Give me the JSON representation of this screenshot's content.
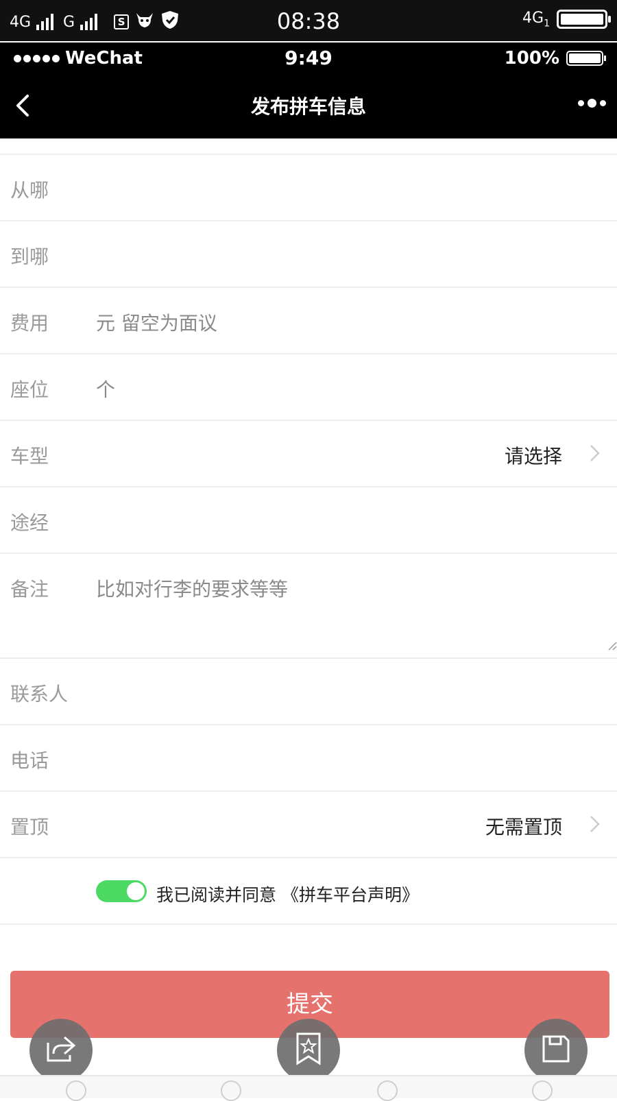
{
  "system_bar": {
    "net1": "4G",
    "net2": "G",
    "s_icon": "S",
    "time": "08:38",
    "net_right": "4G",
    "net_right_sub": "1"
  },
  "wechat_bar": {
    "carrier": "WeChat",
    "time": "9:49",
    "battery": "100%"
  },
  "nav": {
    "title": "发布拼车信息"
  },
  "form": {
    "from_label": "从哪",
    "to_label": "到哪",
    "fee_label": "费用",
    "fee_placeholder": "元 留空为面议",
    "seat_label": "座位",
    "seat_placeholder": "个",
    "car_label": "车型",
    "car_value": "请选择",
    "via_label": "途经",
    "note_label": "备注",
    "note_placeholder": "比如对行李的要求等等",
    "contact_label": "联系人",
    "phone_label": "电话",
    "top_label": "置顶",
    "top_value": "无需置顶",
    "agree_text": "我已阅读并同意 《拼车平台声明》",
    "agree_checked": true
  },
  "submit_label": "提交",
  "colors": {
    "submit": "#e5726c",
    "toggle": "#4cd964",
    "label": "#9a9a9a"
  }
}
